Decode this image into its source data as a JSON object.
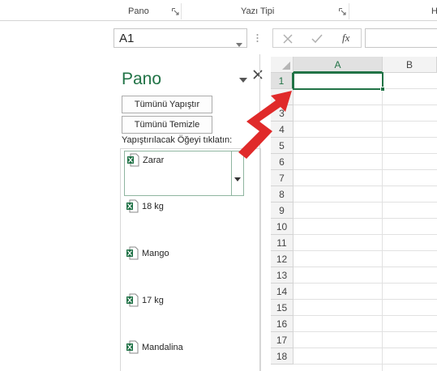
{
  "ribbon": {
    "group_clipboard": "Pano",
    "group_font": "Yazı Tipi",
    "group_next_partial": "H"
  },
  "formula_bar": {
    "name_box": "A1",
    "fx_label": "fx",
    "formula_value": ""
  },
  "clipboard_pane": {
    "title": "Pano",
    "paste_all_button": "Tümünü Yapıştır",
    "clear_all_button": "Tümünü Temizle",
    "instruction": "Yapıştırılacak Öğeyi tıklatın:",
    "items": [
      {
        "label": "Zarar",
        "selected": true
      },
      {
        "label": "18 kg"
      },
      {
        "label": "Mango"
      },
      {
        "label": "17 kg"
      },
      {
        "label": "Mandalina"
      }
    ]
  },
  "sheet": {
    "columns": [
      "A",
      "B"
    ],
    "active_column": "A",
    "rows": [
      "1",
      "2",
      "3",
      "4",
      "5",
      "6",
      "7",
      "8",
      "9",
      "10",
      "11",
      "12",
      "13",
      "14",
      "15",
      "16",
      "17",
      "18"
    ],
    "active_row": "1"
  },
  "colors": {
    "accent": "#217346",
    "annotation_arrow": "#e02a2a",
    "excel_icon": "#1e7145"
  },
  "icons": {
    "launcher": "dialog-launcher-icon",
    "cancel": "cancel-x-icon",
    "enter": "checkmark-icon",
    "pane_menu": "chevron-down-icon",
    "pane_close": "close-icon",
    "clip_item": "excel-file-icon"
  }
}
